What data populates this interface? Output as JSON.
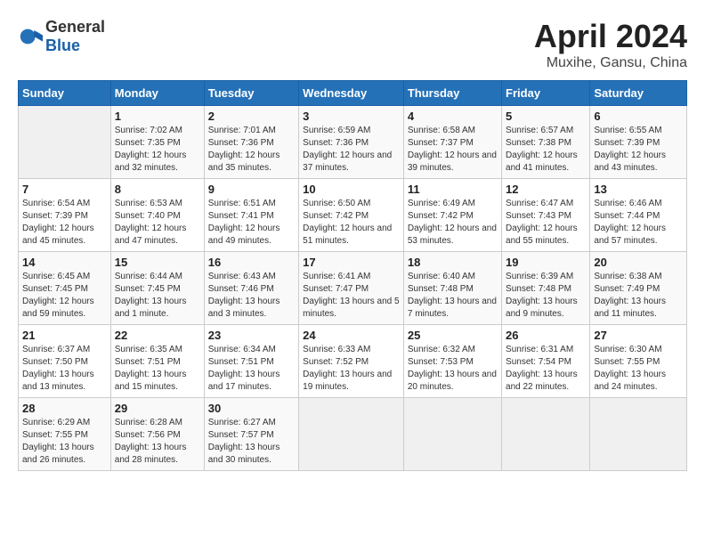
{
  "header": {
    "logo_general": "General",
    "logo_blue": "Blue",
    "month_title": "April 2024",
    "location": "Muxihe, Gansu, China"
  },
  "days_of_week": [
    "Sunday",
    "Monday",
    "Tuesday",
    "Wednesday",
    "Thursday",
    "Friday",
    "Saturday"
  ],
  "weeks": [
    [
      {
        "day": "",
        "sunrise": "",
        "sunset": "",
        "daylight": ""
      },
      {
        "day": "1",
        "sunrise": "7:02 AM",
        "sunset": "7:35 PM",
        "daylight": "12 hours and 32 minutes."
      },
      {
        "day": "2",
        "sunrise": "7:01 AM",
        "sunset": "7:36 PM",
        "daylight": "12 hours and 35 minutes."
      },
      {
        "day": "3",
        "sunrise": "6:59 AM",
        "sunset": "7:36 PM",
        "daylight": "12 hours and 37 minutes."
      },
      {
        "day": "4",
        "sunrise": "6:58 AM",
        "sunset": "7:37 PM",
        "daylight": "12 hours and 39 minutes."
      },
      {
        "day": "5",
        "sunrise": "6:57 AM",
        "sunset": "7:38 PM",
        "daylight": "12 hours and 41 minutes."
      },
      {
        "day": "6",
        "sunrise": "6:55 AM",
        "sunset": "7:39 PM",
        "daylight": "12 hours and 43 minutes."
      }
    ],
    [
      {
        "day": "7",
        "sunrise": "6:54 AM",
        "sunset": "7:39 PM",
        "daylight": "12 hours and 45 minutes."
      },
      {
        "day": "8",
        "sunrise": "6:53 AM",
        "sunset": "7:40 PM",
        "daylight": "12 hours and 47 minutes."
      },
      {
        "day": "9",
        "sunrise": "6:51 AM",
        "sunset": "7:41 PM",
        "daylight": "12 hours and 49 minutes."
      },
      {
        "day": "10",
        "sunrise": "6:50 AM",
        "sunset": "7:42 PM",
        "daylight": "12 hours and 51 minutes."
      },
      {
        "day": "11",
        "sunrise": "6:49 AM",
        "sunset": "7:42 PM",
        "daylight": "12 hours and 53 minutes."
      },
      {
        "day": "12",
        "sunrise": "6:47 AM",
        "sunset": "7:43 PM",
        "daylight": "12 hours and 55 minutes."
      },
      {
        "day": "13",
        "sunrise": "6:46 AM",
        "sunset": "7:44 PM",
        "daylight": "12 hours and 57 minutes."
      }
    ],
    [
      {
        "day": "14",
        "sunrise": "6:45 AM",
        "sunset": "7:45 PM",
        "daylight": "12 hours and 59 minutes."
      },
      {
        "day": "15",
        "sunrise": "6:44 AM",
        "sunset": "7:45 PM",
        "daylight": "13 hours and 1 minute."
      },
      {
        "day": "16",
        "sunrise": "6:43 AM",
        "sunset": "7:46 PM",
        "daylight": "13 hours and 3 minutes."
      },
      {
        "day": "17",
        "sunrise": "6:41 AM",
        "sunset": "7:47 PM",
        "daylight": "13 hours and 5 minutes."
      },
      {
        "day": "18",
        "sunrise": "6:40 AM",
        "sunset": "7:48 PM",
        "daylight": "13 hours and 7 minutes."
      },
      {
        "day": "19",
        "sunrise": "6:39 AM",
        "sunset": "7:48 PM",
        "daylight": "13 hours and 9 minutes."
      },
      {
        "day": "20",
        "sunrise": "6:38 AM",
        "sunset": "7:49 PM",
        "daylight": "13 hours and 11 minutes."
      }
    ],
    [
      {
        "day": "21",
        "sunrise": "6:37 AM",
        "sunset": "7:50 PM",
        "daylight": "13 hours and 13 minutes."
      },
      {
        "day": "22",
        "sunrise": "6:35 AM",
        "sunset": "7:51 PM",
        "daylight": "13 hours and 15 minutes."
      },
      {
        "day": "23",
        "sunrise": "6:34 AM",
        "sunset": "7:51 PM",
        "daylight": "13 hours and 17 minutes."
      },
      {
        "day": "24",
        "sunrise": "6:33 AM",
        "sunset": "7:52 PM",
        "daylight": "13 hours and 19 minutes."
      },
      {
        "day": "25",
        "sunrise": "6:32 AM",
        "sunset": "7:53 PM",
        "daylight": "13 hours and 20 minutes."
      },
      {
        "day": "26",
        "sunrise": "6:31 AM",
        "sunset": "7:54 PM",
        "daylight": "13 hours and 22 minutes."
      },
      {
        "day": "27",
        "sunrise": "6:30 AM",
        "sunset": "7:55 PM",
        "daylight": "13 hours and 24 minutes."
      }
    ],
    [
      {
        "day": "28",
        "sunrise": "6:29 AM",
        "sunset": "7:55 PM",
        "daylight": "13 hours and 26 minutes."
      },
      {
        "day": "29",
        "sunrise": "6:28 AM",
        "sunset": "7:56 PM",
        "daylight": "13 hours and 28 minutes."
      },
      {
        "day": "30",
        "sunrise": "6:27 AM",
        "sunset": "7:57 PM",
        "daylight": "13 hours and 30 minutes."
      },
      {
        "day": "",
        "sunrise": "",
        "sunset": "",
        "daylight": ""
      },
      {
        "day": "",
        "sunrise": "",
        "sunset": "",
        "daylight": ""
      },
      {
        "day": "",
        "sunrise": "",
        "sunset": "",
        "daylight": ""
      },
      {
        "day": "",
        "sunrise": "",
        "sunset": "",
        "daylight": ""
      }
    ]
  ],
  "labels": {
    "sunrise": "Sunrise:",
    "sunset": "Sunset:",
    "daylight": "Daylight:"
  }
}
